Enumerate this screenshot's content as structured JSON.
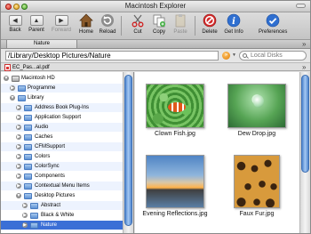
{
  "window": {
    "title": "Macintosh Explorer"
  },
  "toolbar": {
    "back": "Back",
    "parent": "Parent",
    "forward": "Forward",
    "home": "Home",
    "reload": "Reload",
    "cut": "Cut",
    "copy": "Copy",
    "paste": "Paste",
    "delete": "Delete",
    "get_info": "Get Info",
    "preferences": "Preferences"
  },
  "tabs": [
    {
      "label": "Nature"
    }
  ],
  "pathbar": {
    "path": "/Library/Desktop Pictures/Nature",
    "search_placeholder": "Local Disks"
  },
  "shelf": {
    "file": "EC_Pas...al.pdf"
  },
  "tree": {
    "items": [
      {
        "label": "Macintosh HD"
      },
      {
        "label": "Programme"
      },
      {
        "label": "Library"
      },
      {
        "label": "Address Book Plug-Ins"
      },
      {
        "label": "Application Support"
      },
      {
        "label": "Audio"
      },
      {
        "label": "Caches"
      },
      {
        "label": "CFMSupport"
      },
      {
        "label": "Colors"
      },
      {
        "label": "ColorSync"
      },
      {
        "label": "Components"
      },
      {
        "label": "Contextual Menu Items"
      },
      {
        "label": "Desktop Pictures"
      },
      {
        "label": "Abstract"
      },
      {
        "label": "Black & White"
      },
      {
        "label": "Nature"
      }
    ]
  },
  "files": [
    {
      "name": "Clown Fish.jpg"
    },
    {
      "name": "Dew Drop.jpg"
    },
    {
      "name": "Evening Reflections.jpg"
    },
    {
      "name": "Faux Fur.jpg"
    }
  ],
  "colors": {
    "selection": "#3b6fd6",
    "scroll_thumb": "#4f86cf"
  }
}
